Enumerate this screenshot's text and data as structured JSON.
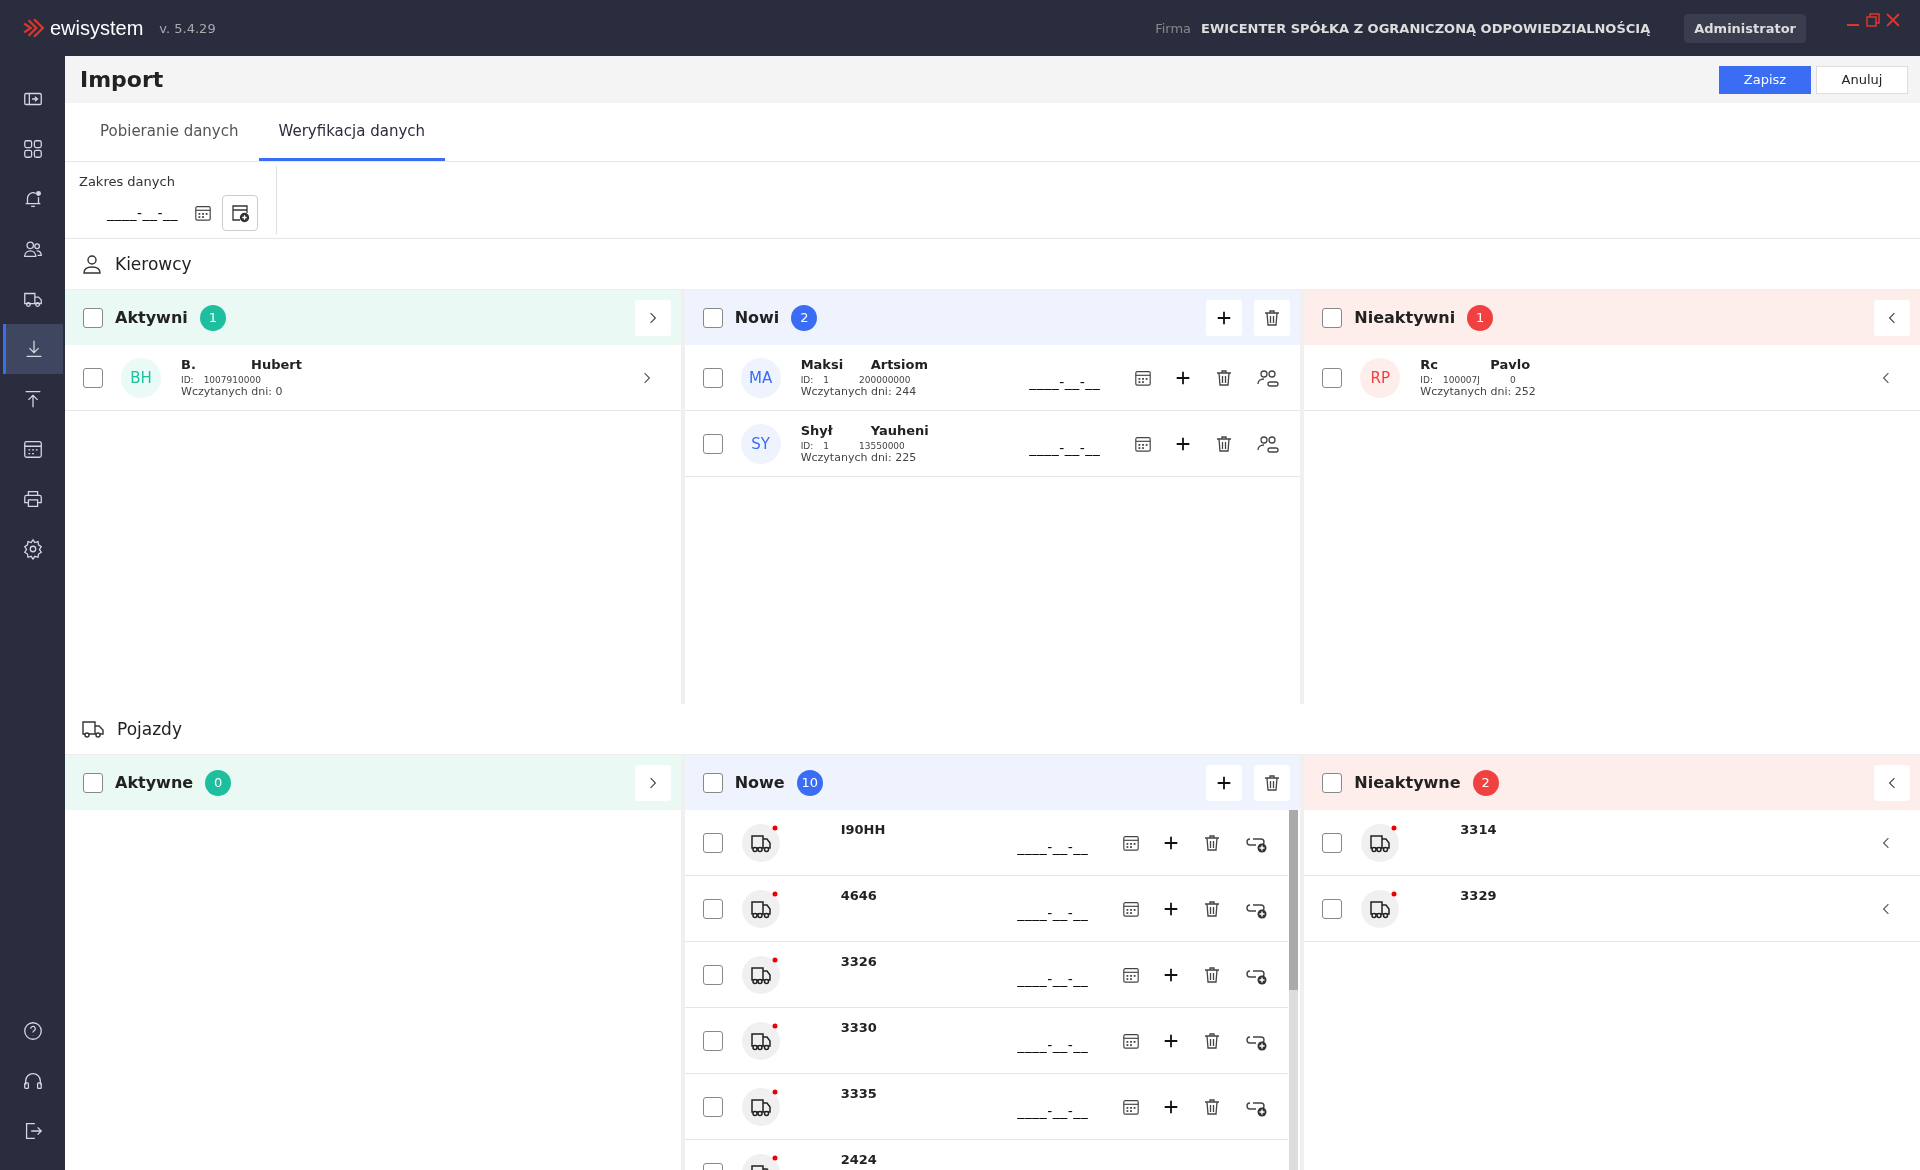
{
  "app": {
    "logo": "ewisystem",
    "version": "v. 5.4.29",
    "company_label": "Firma",
    "company": "EWICENTER SPÓŁKA Z OGRANICZONĄ ODPOWIEDZIALNOŚCIĄ",
    "user": "Administrator"
  },
  "sidebar": {
    "items": [
      {
        "kind": "expand",
        "selected": false
      },
      {
        "kind": "grid",
        "selected": false
      },
      {
        "kind": "bell",
        "selected": false
      },
      {
        "kind": "people",
        "selected": false
      },
      {
        "kind": "truck",
        "selected": false
      },
      {
        "kind": "import",
        "selected": true
      },
      {
        "kind": "export",
        "selected": false
      },
      {
        "kind": "calendar",
        "selected": false
      },
      {
        "kind": "printer",
        "selected": false
      },
      {
        "kind": "settings",
        "selected": false
      }
    ],
    "bottom": [
      {
        "kind": "help"
      },
      {
        "kind": "headset"
      },
      {
        "kind": "logout"
      }
    ]
  },
  "page": {
    "title": "Import",
    "buttons": [
      {
        "label": "Zapisz",
        "kind": "primary"
      },
      {
        "label": "Anuluj",
        "kind": "secondary"
      }
    ]
  },
  "tabs": [
    {
      "label": "Pobieranie danych",
      "selected": false
    },
    {
      "label": "Weryfikacja danych",
      "selected": true
    }
  ],
  "filter": {
    "label": "Zakres danych",
    "date": "____-__-__"
  },
  "sections": [
    {
      "title": "Kierowcy",
      "kind": "drivers",
      "columns": [
        {
          "title": "Aktywni",
          "count": "1",
          "kind": "active",
          "checked": false,
          "rows": [
            {
              "checked": false,
              "initials": "BH",
              "first": "B.",
              "last": "Hubert",
              "id_label": "ID:",
              "id_parts": [
                "1007910000"
              ],
              "days_label": "Wczytanych dni:",
              "days": "0"
            }
          ]
        },
        {
          "title": "Nowi",
          "count": "2",
          "kind": "new",
          "checked": false,
          "rows": [
            {
              "checked": false,
              "initials": "MA",
              "first": "Maksi",
              "last": "Artsiom",
              "id_label": "ID:",
              "id_parts": [
                "1",
                "200000000"
              ],
              "days_label": "Wczytanych dni:",
              "days": "244",
              "date": "____-__-__"
            },
            {
              "checked": false,
              "initials": "SY",
              "first": "Shył",
              "last": "Yauheni",
              "id_label": "ID:",
              "id_parts": [
                "1",
                "13550000"
              ],
              "days_label": "Wczytanych dni:",
              "days": "225",
              "date": "____-__-__"
            }
          ]
        },
        {
          "title": "Nieaktywni",
          "count": "1",
          "kind": "inactive",
          "checked": false,
          "rows": [
            {
              "checked": false,
              "initials": "RP",
              "first": "Rc",
              "last": "Pavlo",
              "id_label": "ID:",
              "id_parts": [
                "100007J",
                "0"
              ],
              "days_label": "Wczytanych dni:",
              "days": "252"
            }
          ]
        }
      ]
    },
    {
      "title": "Pojazdy",
      "kind": "vehicles",
      "columns": [
        {
          "title": "Aktywne",
          "count": "0",
          "kind": "active",
          "checked": false
        },
        {
          "title": "Nowe",
          "count": "10",
          "kind": "new",
          "checked": false,
          "rows": [
            {
              "checked": false,
              "plate": "I90HH",
              "date": "____-__-__"
            },
            {
              "checked": false,
              "plate": "4646",
              "date": "____-__-__"
            },
            {
              "checked": false,
              "plate": "3326",
              "date": "____-__-__"
            },
            {
              "checked": false,
              "plate": "3330",
              "date": "____-__-__"
            },
            {
              "checked": false,
              "plate": "3335",
              "date": "____-__-__"
            },
            {
              "checked": false,
              "plate": "2424"
            }
          ]
        },
        {
          "title": "Nieaktywne",
          "count": "2",
          "kind": "inactive",
          "checked": false,
          "rows": [
            {
              "checked": false,
              "plate": "3314"
            },
            {
              "checked": false,
              "plate": "3329"
            }
          ]
        }
      ]
    }
  ]
}
